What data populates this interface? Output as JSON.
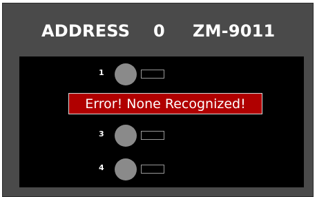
{
  "header": {
    "address_label": "ADDRESS",
    "address_value": "0",
    "model": "ZM-9011"
  },
  "ports": [
    {
      "number": "1",
      "status": "unknown"
    },
    {
      "number": "3",
      "status": "unknown"
    },
    {
      "number": "4",
      "status": "unknown"
    }
  ],
  "error": {
    "message": "Error! None Recognized!"
  },
  "colors": {
    "panel_bg": "#4a4a4a",
    "display_bg": "#000000",
    "led_gray": "#8a8a8a",
    "error_red": "#b00000"
  }
}
